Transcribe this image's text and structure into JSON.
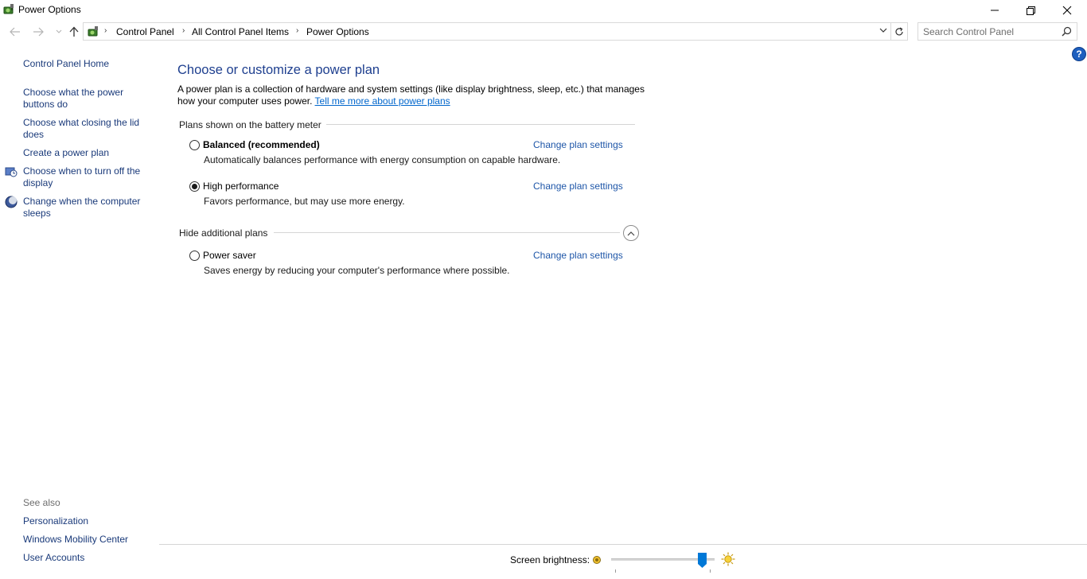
{
  "window": {
    "title": "Power Options"
  },
  "nav": {
    "breadcrumbs": [
      "Control Panel",
      "All Control Panel Items",
      "Power Options"
    ],
    "search_placeholder": "Search Control Panel"
  },
  "sidebar": {
    "home": "Control Panel Home",
    "items": [
      {
        "label": "Choose what the power buttons do"
      },
      {
        "label": "Choose what closing the lid does"
      },
      {
        "label": "Create a power plan"
      },
      {
        "label": "Choose when to turn off the display"
      },
      {
        "label": "Change when the computer sleeps"
      }
    ],
    "see_also_header": "See also",
    "see_also": [
      "Personalization",
      "Windows Mobility Center",
      "User Accounts"
    ]
  },
  "main": {
    "title": "Choose or customize a power plan",
    "intro_text": "A power plan is a collection of hardware and system settings (like display brightness, sleep, etc.) that manages how your computer uses power.",
    "intro_link": "Tell me more about power plans",
    "battery_group_header": "Plans shown on the battery meter",
    "additional_group_header": "Hide additional plans",
    "plans": [
      {
        "name": "Balanced (recommended)",
        "description": "Automatically balances performance with energy consumption on capable hardware.",
        "link": "Change plan settings",
        "selected": false
      },
      {
        "name": "High performance",
        "description": "Favors performance, but may use more energy.",
        "link": "Change plan settings",
        "selected": true
      },
      {
        "name": "Power saver",
        "description": "Saves energy by reducing your computer's performance where possible.",
        "link": "Change plan settings",
        "selected": false
      }
    ]
  },
  "footer": {
    "brightness_label": "Screen brightness:",
    "brightness_level": 0.92
  },
  "help_label": "?",
  "colors": {
    "link": "#1a3a7a",
    "title": "#1e3f8f",
    "accent": "#0078d7"
  }
}
